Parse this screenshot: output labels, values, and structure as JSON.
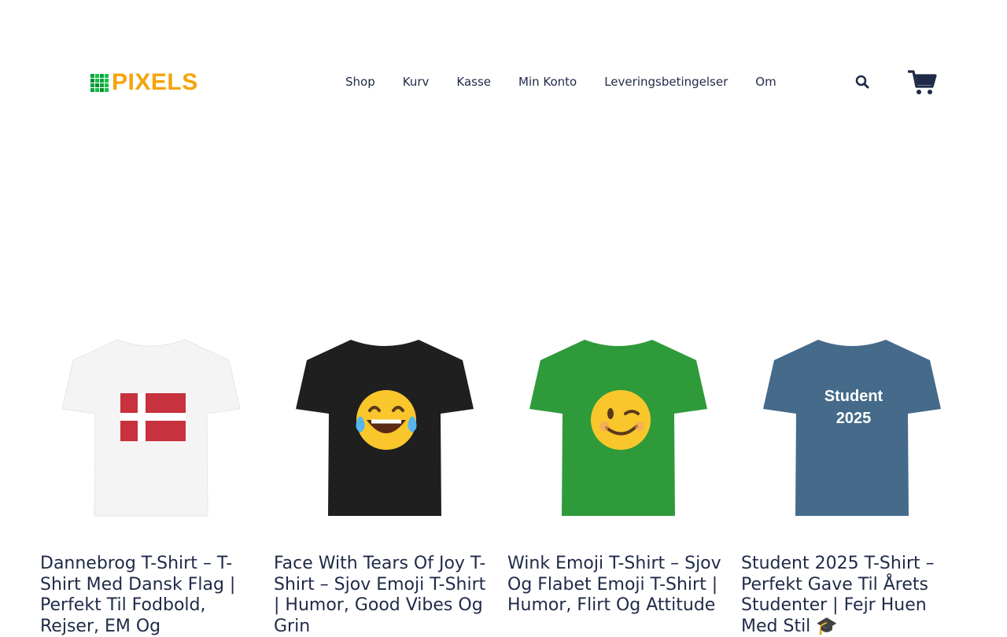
{
  "header": {
    "logo_text": "PIXELS",
    "nav": [
      "Shop",
      "Kurv",
      "Kasse",
      "Min Konto",
      "Leveringsbetingelser",
      "Om"
    ]
  },
  "products": [
    {
      "title": "Dannebrog T-Shirt – T-Shirt Med Dansk Flag | Perfekt Til Fodbold, Rejser, EM Og",
      "shirt_color": "#f4f4f4",
      "print": "flag-icon"
    },
    {
      "title": "Face With Tears Of Joy T-Shirt – Sjov Emoji T-Shirt | Humor, Good Vibes Og Grin",
      "shirt_color": "#1f1f1f",
      "print": "laughing-emoji-icon"
    },
    {
      "title": "Wink Emoji T-Shirt – Sjov Og Flabet Emoji T-Shirt | Humor, Flirt Og Attitude",
      "shirt_color": "#2f9a3a",
      "print": "wink-emoji-icon"
    },
    {
      "title": "Student 2025 T-Shirt – Perfekt Gave Til Årets Studenter | Fejr Huen Med Stil 🎓",
      "shirt_color": "#456a8a",
      "print_text": [
        "Student",
        "2025"
      ]
    }
  ],
  "colors": {
    "nav_text": "#1f2a48",
    "logo": "#f5a40a",
    "logo_grid": "#0aa33a"
  }
}
